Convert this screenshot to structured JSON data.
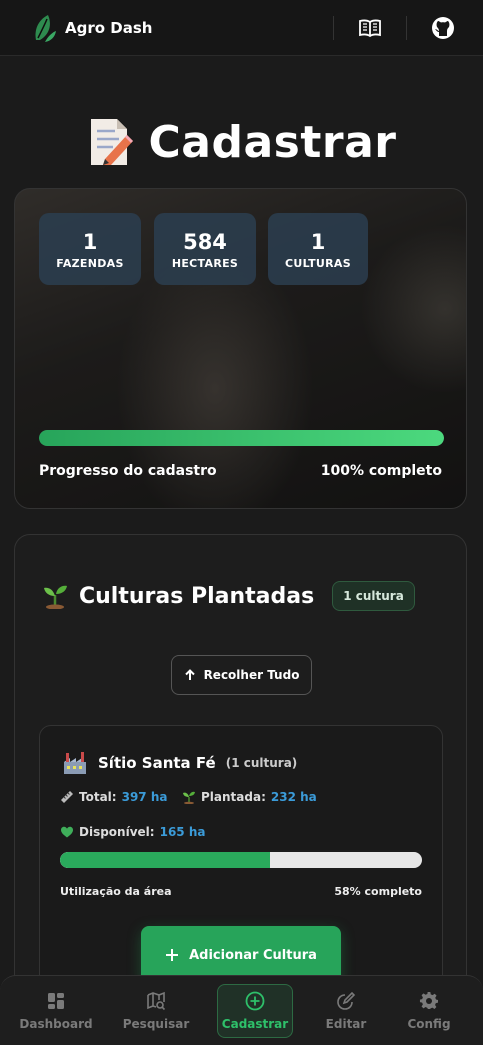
{
  "header": {
    "app_name": "Agro Dash",
    "icons": [
      "leaf-logo-icon",
      "book-icon",
      "github-icon"
    ]
  },
  "page": {
    "title": "Cadastrar",
    "title_icon": "memo-icon"
  },
  "summary": {
    "stats": [
      {
        "value": "1",
        "label": "FAZENDAS"
      },
      {
        "value": "584",
        "label": "HECTARES"
      },
      {
        "value": "1",
        "label": "CULTURAS"
      }
    ],
    "progress_percent": 100,
    "progress_label": "Progresso do cadastro",
    "progress_status": "100% completo"
  },
  "cultures": {
    "heading": "Culturas Plantadas",
    "heading_icon": "seedling-icon",
    "count_badge": "1 cultura",
    "collapse_label": "Recolher Tudo",
    "farm": {
      "name": "Sítio Santa Fé",
      "count": "(1 cultura)",
      "icon": "factory-icon",
      "total_label": "Total:",
      "total_value": "397 ha",
      "planted_label": "Plantada:",
      "planted_value": "232 ha",
      "available_label": "Disponível:",
      "available_value": "165 ha",
      "usage_percent": 58,
      "usage_label": "Utilização da área",
      "usage_status": "58% completo",
      "add_label": "Adicionar Cultura"
    }
  },
  "nav": {
    "items": [
      {
        "label": "Dashboard",
        "icon": "grid-icon"
      },
      {
        "label": "Pesquisar",
        "icon": "map-search-icon"
      },
      {
        "label": "Cadastrar",
        "icon": "plus-circle-icon"
      },
      {
        "label": "Editar",
        "icon": "edit-icon"
      },
      {
        "label": "Config",
        "icon": "gear-icon"
      }
    ],
    "active": "Cadastrar"
  },
  "colors": {
    "accent": "#2ec06a",
    "progress": "#27a45a",
    "value_blue": "#3b9bd8"
  }
}
